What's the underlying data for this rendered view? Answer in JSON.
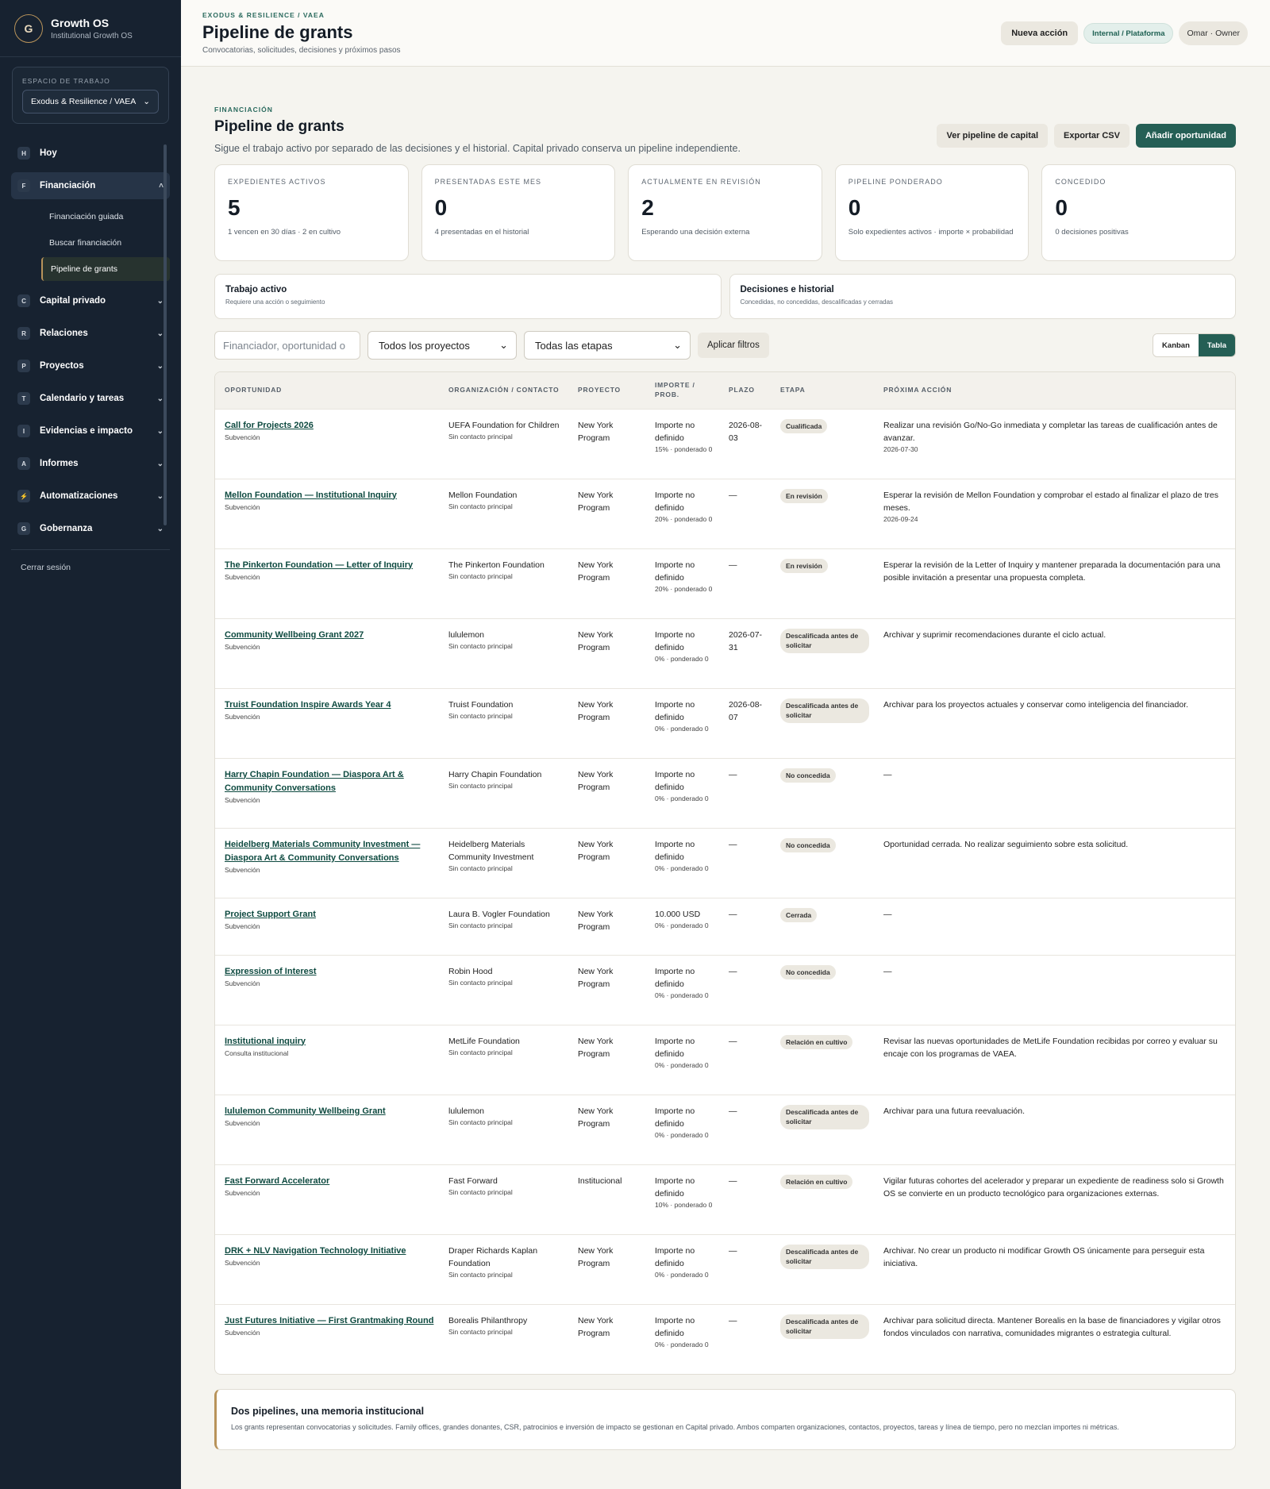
{
  "brand": {
    "logo": "G",
    "name": "Growth OS",
    "sub": "Institutional Growth OS"
  },
  "workspace": {
    "label": "ESPACIO DE TRABAJO",
    "value": "Exodus & Resilience / VAEA"
  },
  "nav": {
    "hoy": {
      "letter": "H",
      "label": "Hoy"
    },
    "financiacion": {
      "letter": "F",
      "label": "Financiación",
      "sub": [
        "Financiación guiada",
        "Buscar financiación",
        "Pipeline de grants"
      ]
    },
    "capital": {
      "letter": "C",
      "label": "Capital privado"
    },
    "relaciones": {
      "letter": "R",
      "label": "Relaciones"
    },
    "proyectos": {
      "letter": "P",
      "label": "Proyectos"
    },
    "calendario": {
      "letter": "T",
      "label": "Calendario y tareas"
    },
    "evidencias": {
      "letter": "I",
      "label": "Evidencias e impacto"
    },
    "informes": {
      "letter": "A",
      "label": "Informes"
    },
    "automatizaciones": {
      "letter": "⚡",
      "label": "Automatizaciones"
    },
    "gobernanza": {
      "letter": "G",
      "label": "Gobernanza"
    }
  },
  "logout": "Cerrar sesión",
  "topbar": {
    "crumb": "EXODUS & RESILIENCE / VAEA",
    "title": "Pipeline de grants",
    "sub": "Convocatorias, solicitudes, decisiones y próximos pasos",
    "action": "Nueva acción",
    "tag": "Internal / Plataforma",
    "user": "Omar · Owner"
  },
  "section": {
    "eyebrow": "FINANCIACIÓN",
    "title": "Pipeline de grants",
    "sub": "Sigue el trabajo activo por separado de las decisiones y el historial. Capital privado conserva un pipeline independiente.",
    "btn_capital": "Ver pipeline de capital",
    "btn_export": "Exportar CSV",
    "btn_add": "Añadir oportunidad"
  },
  "metrics": [
    {
      "label": "EXPEDIENTES ACTIVOS",
      "value": "5",
      "note": "1 vencen en 30 días · 2 en cultivo"
    },
    {
      "label": "PRESENTADAS ESTE MES",
      "value": "0",
      "note": "4 presentadas en el historial"
    },
    {
      "label": "ACTUALMENTE EN REVISIÓN",
      "value": "2",
      "note": "Esperando una decisión externa"
    },
    {
      "label": "PIPELINE PONDERADO",
      "value": "0",
      "note": "Solo expedientes activos · importe × probabilidad"
    },
    {
      "label": "CONCEDIDO",
      "value": "0",
      "note": "0 decisiones positivas"
    }
  ],
  "tabs": [
    {
      "title": "Trabajo activo",
      "sub": "Requiere una acción o seguimiento"
    },
    {
      "title": "Decisiones e historial",
      "sub": "Concedidas, no concedidas, descalificadas y cerradas"
    }
  ],
  "filters": {
    "search_placeholder": "Financiador, oportunidad o",
    "project": "Todos los proyectos",
    "stage": "Todas las etapas",
    "apply": "Aplicar filtros",
    "kanban": "Kanban",
    "tabla": "Tabla"
  },
  "table": {
    "headers": [
      "OPORTUNIDAD",
      "ORGANIZACIÓN / CONTACTO",
      "PROYECTO",
      "IMPORTE / PROB.",
      "PLAZO",
      "ETAPA",
      "PRÓXIMA ACCIÓN"
    ],
    "rows": [
      {
        "name": "Call for Projects 2026",
        "type": "Subvención",
        "org": "UEFA Foundation for Children",
        "contact": "Sin contacto principal",
        "project": "New York Program",
        "amount": "Importe no definido",
        "prob": "15% · ponderado 0",
        "deadline": "2026-08-03",
        "stage": "Cualificada",
        "action": "Realizar una revisión Go/No-Go inmediata y completar las tareas de cualificación antes de avanzar.",
        "action_date": "2026-07-30"
      },
      {
        "name": "Mellon Foundation — Institutional Inquiry",
        "type": "Subvención",
        "org": "Mellon Foundation",
        "contact": "Sin contacto principal",
        "project": "New York Program",
        "amount": "Importe no definido",
        "prob": "20% · ponderado 0",
        "deadline": "—",
        "stage": "En revisión",
        "action": "Esperar la revisión de Mellon Foundation y comprobar el estado al finalizar el plazo de tres meses.",
        "action_date": "2026-09-24"
      },
      {
        "name": "The Pinkerton Foundation — Letter of Inquiry",
        "type": "Subvención",
        "org": "The Pinkerton Foundation",
        "contact": "Sin contacto principal",
        "project": "New York Program",
        "amount": "Importe no definido",
        "prob": "20% · ponderado 0",
        "deadline": "—",
        "stage": "En revisión",
        "action": "Esperar la revisión de la Letter of Inquiry y mantener preparada la documentación para una posible invitación a presentar una propuesta completa.",
        "action_date": ""
      },
      {
        "name": "Community Wellbeing Grant 2027",
        "type": "Subvención",
        "org": "lululemon",
        "contact": "Sin contacto principal",
        "project": "New York Program",
        "amount": "Importe no definido",
        "prob": "0% · ponderado 0",
        "deadline": "2026-07-31",
        "stage": "Descalificada antes de solicitar",
        "action": "Archivar y suprimir recomendaciones durante el ciclo actual.",
        "action_date": ""
      },
      {
        "name": "Truist Foundation Inspire Awards Year 4",
        "type": "Subvención",
        "org": "Truist Foundation",
        "contact": "Sin contacto principal",
        "project": "New York Program",
        "amount": "Importe no definido",
        "prob": "0% · ponderado 0",
        "deadline": "2026-08-07",
        "stage": "Descalificada antes de solicitar",
        "action": "Archivar para los proyectos actuales y conservar como inteligencia del financiador.",
        "action_date": ""
      },
      {
        "name": "Harry Chapin Foundation — Diaspora Art & Community Conversations",
        "type": "Subvención",
        "org": "Harry Chapin Foundation",
        "contact": "Sin contacto principal",
        "project": "New York Program",
        "amount": "Importe no definido",
        "prob": "0% · ponderado 0",
        "deadline": "—",
        "stage": "No concedida",
        "action": "—",
        "action_date": ""
      },
      {
        "name": "Heidelberg Materials Community Investment — Diaspora Art & Community Conversations",
        "type": "Subvención",
        "org": "Heidelberg Materials Community Investment",
        "contact": "Sin contacto principal",
        "project": "New York Program",
        "amount": "Importe no definido",
        "prob": "0% · ponderado 0",
        "deadline": "—",
        "stage": "No concedida",
        "action": "Oportunidad cerrada. No realizar seguimiento sobre esta solicitud.",
        "action_date": ""
      },
      {
        "name": "Project Support Grant",
        "type": "Subvención",
        "org": "Laura B. Vogler Foundation",
        "contact": "Sin contacto principal",
        "project": "New York Program",
        "amount": "10.000 USD",
        "prob": "0% · ponderado 0",
        "deadline": "—",
        "stage": "Cerrada",
        "action": "—",
        "action_date": ""
      },
      {
        "name": "Expression of Interest",
        "type": "Subvención",
        "org": "Robin Hood",
        "contact": "Sin contacto principal",
        "project": "New York Program",
        "amount": "Importe no definido",
        "prob": "0% · ponderado 0",
        "deadline": "—",
        "stage": "No concedida",
        "action": "—",
        "action_date": ""
      },
      {
        "name": "Institutional inquiry",
        "type": "Consulta institucional",
        "org": "MetLife Foundation",
        "contact": "Sin contacto principal",
        "project": "New York Program",
        "amount": "Importe no definido",
        "prob": "0% · ponderado 0",
        "deadline": "—",
        "stage": "Relación en cultivo",
        "action": "Revisar las nuevas oportunidades de MetLife Foundation recibidas por correo y evaluar su encaje con los programas de VAEA.",
        "action_date": ""
      },
      {
        "name": "lululemon Community Wellbeing Grant",
        "type": "Subvención",
        "org": "lululemon",
        "contact": "Sin contacto principal",
        "project": "New York Program",
        "amount": "Importe no definido",
        "prob": "0% · ponderado 0",
        "deadline": "—",
        "stage": "Descalificada antes de solicitar",
        "action": "Archivar para una futura reevaluación.",
        "action_date": ""
      },
      {
        "name": "Fast Forward Accelerator",
        "type": "Subvención",
        "org": "Fast Forward",
        "contact": "Sin contacto principal",
        "project": "Institucional",
        "amount": "Importe no definido",
        "prob": "10% · ponderado 0",
        "deadline": "—",
        "stage": "Relación en cultivo",
        "action": "Vigilar futuras cohortes del acelerador y preparar un expediente de readiness solo si Growth OS se convierte en un producto tecnológico para organizaciones externas.",
        "action_date": ""
      },
      {
        "name": "DRK + NLV Navigation Technology Initiative",
        "type": "Subvención",
        "org": "Draper Richards Kaplan Foundation",
        "contact": "Sin contacto principal",
        "project": "New York Program",
        "amount": "Importe no definido",
        "prob": "0% · ponderado 0",
        "deadline": "—",
        "stage": "Descalificada antes de solicitar",
        "action": "Archivar. No crear un producto ni modificar Growth OS únicamente para perseguir esta iniciativa.",
        "action_date": ""
      },
      {
        "name": "Just Futures Initiative — First Grantmaking Round",
        "type": "Subvención",
        "org": "Borealis Philanthropy",
        "contact": "Sin contacto principal",
        "project": "New York Program",
        "amount": "Importe no definido",
        "prob": "0% · ponderado 0",
        "deadline": "—",
        "stage": "Descalificada antes de solicitar",
        "action": "Archivar para solicitud directa. Mantener Borealis en la base de financiadores y vigilar otros fondos vinculados con narrativa, comunidades migrantes o estrategia cultural.",
        "action_date": ""
      }
    ]
  },
  "note": {
    "title": "Dos pipelines, una memoria institucional",
    "text": "Los grants representan convocatorias y solicitudes. Family offices, grandes donantes, CSR, patrocinios e inversión de impacto se gestionan en Capital privado. Ambos comparten organizaciones, contactos, proyectos, tareas y línea de tiempo, pero no mezclan importes ni métricas."
  },
  "colors": {
    "accent": "#255f55",
    "gold": "#b8935a",
    "sidebar": "#172230"
  }
}
